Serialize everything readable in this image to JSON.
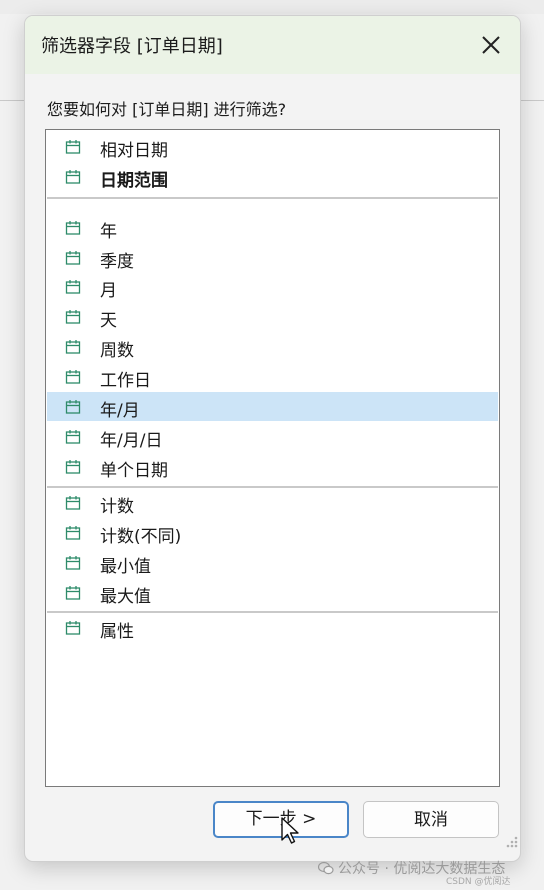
{
  "dialog": {
    "title": "筛选器字段 [订单日期]",
    "prompt": "您要如何对 [订单日期] 进行筛选?"
  },
  "list": {
    "selected_label": "年/月",
    "groups": [
      {
        "items": [
          "相对日期",
          "日期范围"
        ]
      },
      {
        "items": [
          "年",
          "季度",
          "月",
          "天",
          "周数",
          "工作日",
          "年/月",
          "年/月/日",
          "单个日期"
        ]
      },
      {
        "items": [
          "计数",
          "计数(不同)",
          "最小值",
          "最大值"
        ]
      },
      {
        "items": [
          "属性"
        ]
      }
    ]
  },
  "buttons": {
    "next_label": "下一步 >",
    "cancel_label": "取消"
  },
  "watermark": {
    "text": "公众号 · 优阅达大数据生态",
    "subtext": "CSDN @优阅达"
  },
  "icons": {
    "item_icon": "calendar-icon",
    "close_icon": "close-icon"
  },
  "colors": {
    "titlebar_bg": "#ebf3e6",
    "selected_bg": "#cce4f7",
    "icon_color": "#2e8b6a",
    "default_button_border": "#4a86c8"
  }
}
